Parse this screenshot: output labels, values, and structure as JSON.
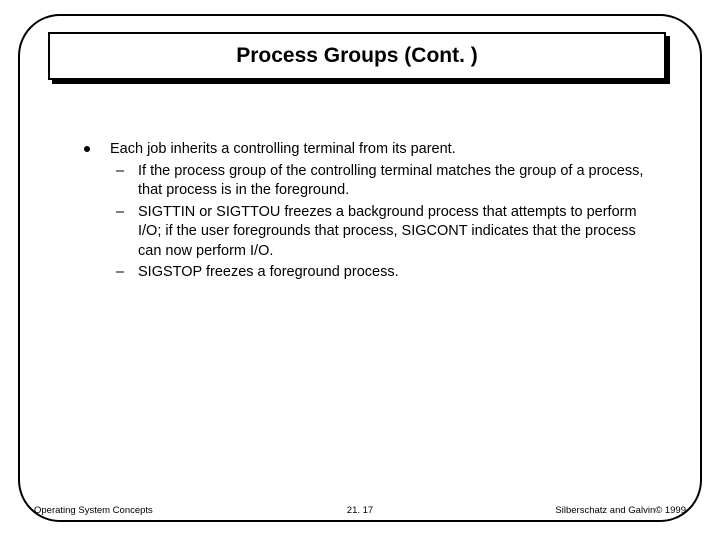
{
  "title": "Process Groups (Cont. )",
  "bullets": [
    {
      "text": "Each job inherits a controlling terminal from its parent.",
      "sub": [
        "If the process group of the controlling terminal matches the group of a process, that process is in the foreground.",
        "SIGTTIN or SIGTTOU freezes a background process that attempts to perform I/O; if the user foregrounds that process, SIGCONT indicates that the process can now perform I/O.",
        "SIGSTOP freezes a foreground process."
      ]
    }
  ],
  "footer": {
    "left": "Operating System Concepts",
    "center": "21. 17",
    "right": "Silberschatz and Galvin© 1999"
  }
}
